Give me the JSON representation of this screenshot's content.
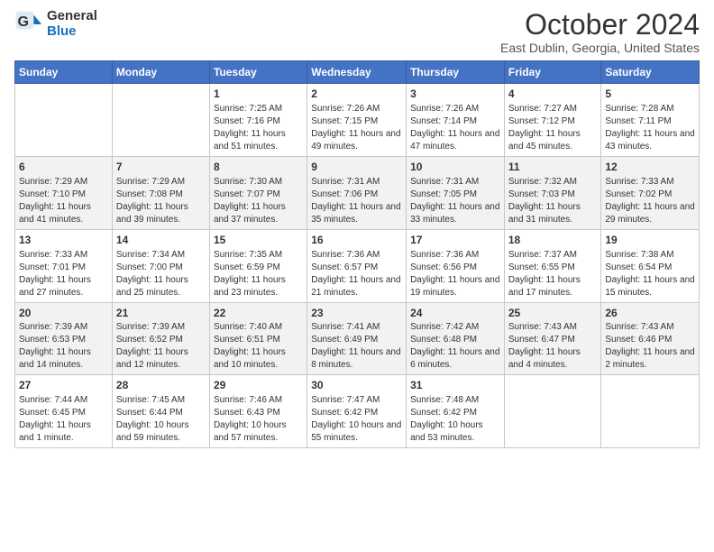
{
  "logo": {
    "general": "General",
    "blue": "Blue"
  },
  "title": {
    "month": "October 2024",
    "location": "East Dublin, Georgia, United States"
  },
  "headers": [
    "Sunday",
    "Monday",
    "Tuesday",
    "Wednesday",
    "Thursday",
    "Friday",
    "Saturday"
  ],
  "weeks": [
    [
      {
        "day": "",
        "info": ""
      },
      {
        "day": "",
        "info": ""
      },
      {
        "day": "1",
        "info": "Sunrise: 7:25 AM\nSunset: 7:16 PM\nDaylight: 11 hours and 51 minutes."
      },
      {
        "day": "2",
        "info": "Sunrise: 7:26 AM\nSunset: 7:15 PM\nDaylight: 11 hours and 49 minutes."
      },
      {
        "day": "3",
        "info": "Sunrise: 7:26 AM\nSunset: 7:14 PM\nDaylight: 11 hours and 47 minutes."
      },
      {
        "day": "4",
        "info": "Sunrise: 7:27 AM\nSunset: 7:12 PM\nDaylight: 11 hours and 45 minutes."
      },
      {
        "day": "5",
        "info": "Sunrise: 7:28 AM\nSunset: 7:11 PM\nDaylight: 11 hours and 43 minutes."
      }
    ],
    [
      {
        "day": "6",
        "info": "Sunrise: 7:29 AM\nSunset: 7:10 PM\nDaylight: 11 hours and 41 minutes."
      },
      {
        "day": "7",
        "info": "Sunrise: 7:29 AM\nSunset: 7:08 PM\nDaylight: 11 hours and 39 minutes."
      },
      {
        "day": "8",
        "info": "Sunrise: 7:30 AM\nSunset: 7:07 PM\nDaylight: 11 hours and 37 minutes."
      },
      {
        "day": "9",
        "info": "Sunrise: 7:31 AM\nSunset: 7:06 PM\nDaylight: 11 hours and 35 minutes."
      },
      {
        "day": "10",
        "info": "Sunrise: 7:31 AM\nSunset: 7:05 PM\nDaylight: 11 hours and 33 minutes."
      },
      {
        "day": "11",
        "info": "Sunrise: 7:32 AM\nSunset: 7:03 PM\nDaylight: 11 hours and 31 minutes."
      },
      {
        "day": "12",
        "info": "Sunrise: 7:33 AM\nSunset: 7:02 PM\nDaylight: 11 hours and 29 minutes."
      }
    ],
    [
      {
        "day": "13",
        "info": "Sunrise: 7:33 AM\nSunset: 7:01 PM\nDaylight: 11 hours and 27 minutes."
      },
      {
        "day": "14",
        "info": "Sunrise: 7:34 AM\nSunset: 7:00 PM\nDaylight: 11 hours and 25 minutes."
      },
      {
        "day": "15",
        "info": "Sunrise: 7:35 AM\nSunset: 6:59 PM\nDaylight: 11 hours and 23 minutes."
      },
      {
        "day": "16",
        "info": "Sunrise: 7:36 AM\nSunset: 6:57 PM\nDaylight: 11 hours and 21 minutes."
      },
      {
        "day": "17",
        "info": "Sunrise: 7:36 AM\nSunset: 6:56 PM\nDaylight: 11 hours and 19 minutes."
      },
      {
        "day": "18",
        "info": "Sunrise: 7:37 AM\nSunset: 6:55 PM\nDaylight: 11 hours and 17 minutes."
      },
      {
        "day": "19",
        "info": "Sunrise: 7:38 AM\nSunset: 6:54 PM\nDaylight: 11 hours and 15 minutes."
      }
    ],
    [
      {
        "day": "20",
        "info": "Sunrise: 7:39 AM\nSunset: 6:53 PM\nDaylight: 11 hours and 14 minutes."
      },
      {
        "day": "21",
        "info": "Sunrise: 7:39 AM\nSunset: 6:52 PM\nDaylight: 11 hours and 12 minutes."
      },
      {
        "day": "22",
        "info": "Sunrise: 7:40 AM\nSunset: 6:51 PM\nDaylight: 11 hours and 10 minutes."
      },
      {
        "day": "23",
        "info": "Sunrise: 7:41 AM\nSunset: 6:49 PM\nDaylight: 11 hours and 8 minutes."
      },
      {
        "day": "24",
        "info": "Sunrise: 7:42 AM\nSunset: 6:48 PM\nDaylight: 11 hours and 6 minutes."
      },
      {
        "day": "25",
        "info": "Sunrise: 7:43 AM\nSunset: 6:47 PM\nDaylight: 11 hours and 4 minutes."
      },
      {
        "day": "26",
        "info": "Sunrise: 7:43 AM\nSunset: 6:46 PM\nDaylight: 11 hours and 2 minutes."
      }
    ],
    [
      {
        "day": "27",
        "info": "Sunrise: 7:44 AM\nSunset: 6:45 PM\nDaylight: 11 hours and 1 minute."
      },
      {
        "day": "28",
        "info": "Sunrise: 7:45 AM\nSunset: 6:44 PM\nDaylight: 10 hours and 59 minutes."
      },
      {
        "day": "29",
        "info": "Sunrise: 7:46 AM\nSunset: 6:43 PM\nDaylight: 10 hours and 57 minutes."
      },
      {
        "day": "30",
        "info": "Sunrise: 7:47 AM\nSunset: 6:42 PM\nDaylight: 10 hours and 55 minutes."
      },
      {
        "day": "31",
        "info": "Sunrise: 7:48 AM\nSunset: 6:42 PM\nDaylight: 10 hours and 53 minutes."
      },
      {
        "day": "",
        "info": ""
      },
      {
        "day": "",
        "info": ""
      }
    ]
  ]
}
